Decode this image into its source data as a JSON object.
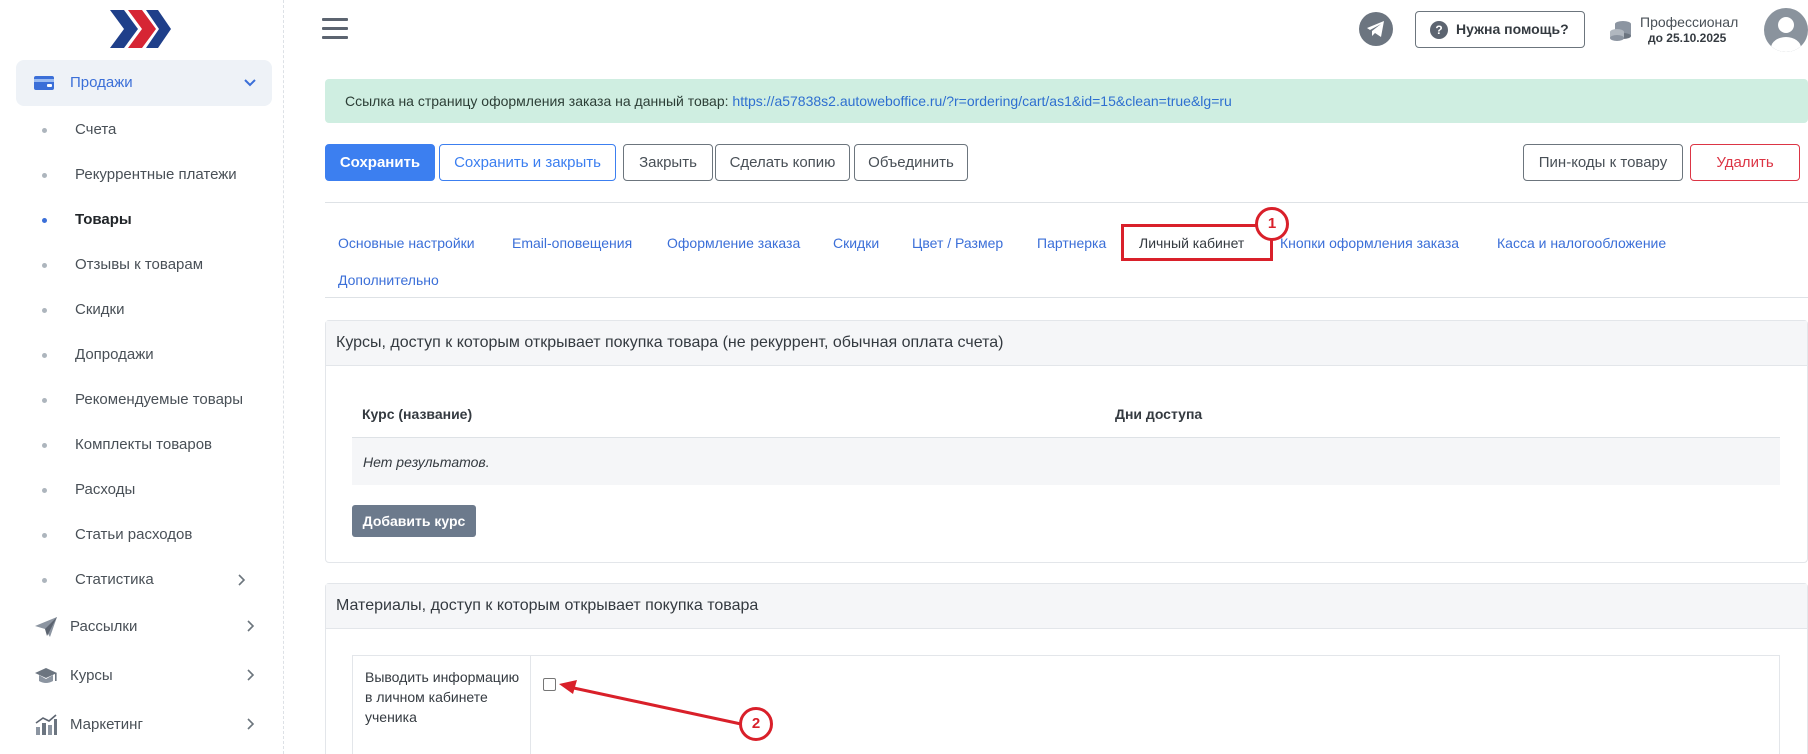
{
  "sidebar": {
    "logo": "autowebofficelogo",
    "sales": {
      "label": "Продажи",
      "icon": "wallet-icon"
    },
    "sub_items": [
      {
        "label": "Счета"
      },
      {
        "label": "Рекуррентные платежи"
      },
      {
        "label": "Товары",
        "active": true
      },
      {
        "label": "Отзывы к товарам"
      },
      {
        "label": "Скидки"
      },
      {
        "label": "Допродажи"
      },
      {
        "label": "Рекомендуемые товары"
      },
      {
        "label": "Комплекты товаров"
      },
      {
        "label": "Расходы"
      },
      {
        "label": "Статьи расходов"
      },
      {
        "label": "Статистика"
      }
    ],
    "main_items": [
      {
        "label": "Рассылки",
        "icon": "paper-plane-icon"
      },
      {
        "label": "Курсы",
        "icon": "graduation-cap-icon"
      },
      {
        "label": "Маркетинг",
        "icon": "chart-icon"
      }
    ]
  },
  "header": {
    "help_label": "Нужна помощь?",
    "plan_name": "Профессионал",
    "plan_until": "до 25.10.2025"
  },
  "alert": {
    "text": "Ссылка на страницу оформления заказа на данный товар: ",
    "link": "https://a57838s2.autoweboffice.ru/?r=ordering/cart/as1&id=15&clean=true&lg=ru"
  },
  "toolbar": {
    "save": "Сохранить",
    "save_close": "Сохранить и закрыть",
    "close": "Закрыть",
    "copy": "Сделать копию",
    "merge": "Объединить",
    "pins": "Пин-коды к товару",
    "delete": "Удалить"
  },
  "tabs": [
    "Основные настройки",
    "Email-оповещения",
    "Оформление заказа",
    "Скидки",
    "Цвет / Размер",
    "Партнерка",
    "Личный кабинет",
    "Кнопки оформления заказа",
    "Касса и налогообложение",
    "Дополнительно"
  ],
  "active_tab": "Личный кабинет",
  "annotations": {
    "badge1": "1",
    "badge2": "2"
  },
  "courses_card": {
    "title": "Курсы, доступ к которым открывает покупка товара (не рекуррент, обычная оплата счета)",
    "col_name": "Курс (название)",
    "col_days": "Дни доступа",
    "empty": "Нет результатов.",
    "add_button": "Добавить курс"
  },
  "materials_card": {
    "title": "Материалы, доступ к которым открывает покупка товара",
    "show_info_label": "Выводить информацию в личном кабинете ученика",
    "show_info_checked": false
  },
  "colors": {
    "accent": "#3c7ff0",
    "annotation": "#d9202a",
    "alert_bg": "#cfeee1"
  }
}
